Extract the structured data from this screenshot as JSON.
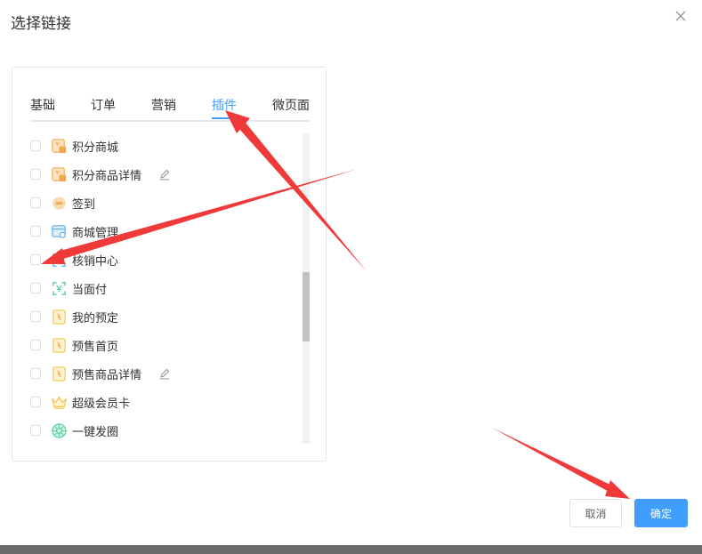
{
  "dialog": {
    "title": "选择链接",
    "close_icon": "close-icon"
  },
  "tabs": [
    {
      "label": "基础",
      "active": false
    },
    {
      "label": "订单",
      "active": false
    },
    {
      "label": "营销",
      "active": false
    },
    {
      "label": "插件",
      "active": true
    },
    {
      "label": "微页面",
      "active": false
    }
  ],
  "items": [
    {
      "label": "积分商城",
      "icon": "points-mall-icon",
      "editable": false
    },
    {
      "label": "积分商品详情",
      "icon": "points-goods-icon",
      "editable": true
    },
    {
      "label": "签到",
      "icon": "sign-in-icon",
      "editable": false
    },
    {
      "label": "商城管理",
      "icon": "mall-manage-icon",
      "editable": false
    },
    {
      "label": "核销中心",
      "icon": "verify-center-icon",
      "editable": false
    },
    {
      "label": "当面付",
      "icon": "face-pay-icon",
      "editable": false
    },
    {
      "label": "我的预定",
      "icon": "my-booking-icon",
      "editable": false
    },
    {
      "label": "预售首页",
      "icon": "presale-home-icon",
      "editable": false
    },
    {
      "label": "预售商品详情",
      "icon": "presale-goods-icon",
      "editable": true
    },
    {
      "label": "超级会员卡",
      "icon": "crown-icon",
      "editable": false
    },
    {
      "label": "一键发圈",
      "icon": "share-circle-icon",
      "editable": false
    }
  ],
  "footer": {
    "cancel_label": "取消",
    "confirm_label": "确定"
  },
  "colors": {
    "accent": "#409eff",
    "annotation_arrow": "#f03a3a",
    "orange_icon": "#f5a84a",
    "blue_icon": "#5ab0f0",
    "green_icon": "#4ecf9a",
    "yellow_icon": "#f6c548"
  }
}
